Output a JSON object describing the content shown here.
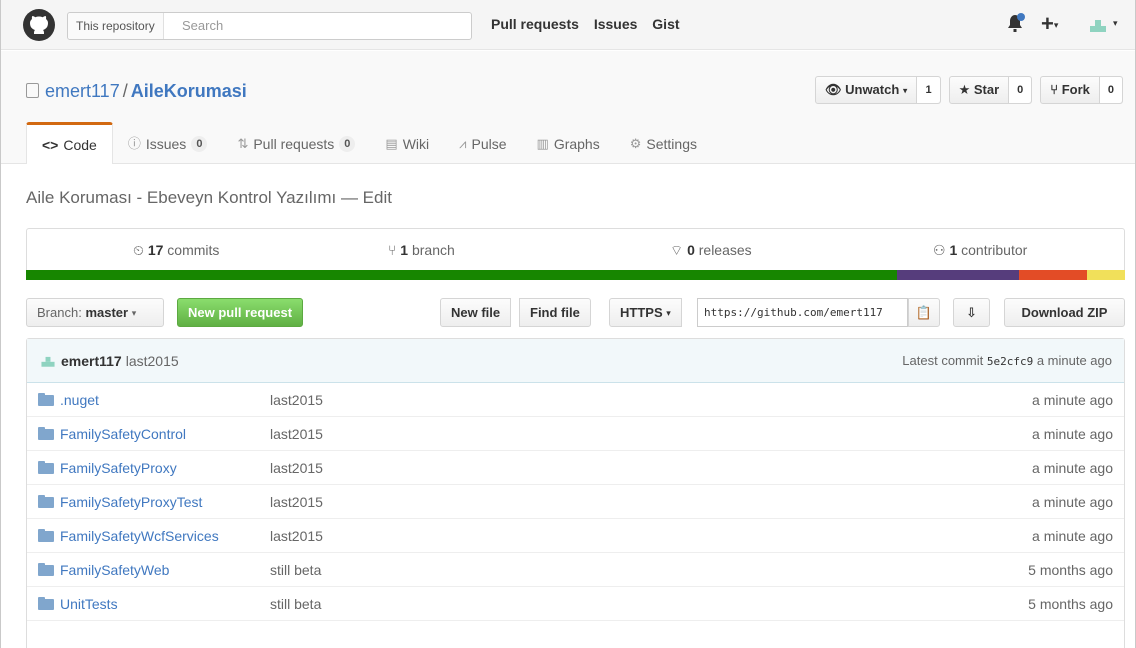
{
  "header": {
    "search_scope": "This repository",
    "search_placeholder": "Search",
    "nav": [
      "Pull requests",
      "Issues",
      "Gist"
    ],
    "plus_label": "+"
  },
  "repo": {
    "owner": "emert117",
    "separator": "/",
    "name": "AileKorumasi",
    "watch_label": "Unwatch",
    "watch_count": "1",
    "star_label": "Star",
    "star_count": "0",
    "fork_label": "Fork",
    "fork_count": "0"
  },
  "tabs": [
    {
      "label": "Code",
      "icon": "code-icon"
    },
    {
      "label": "Issues",
      "count": "0",
      "icon": "issue-icon"
    },
    {
      "label": "Pull requests",
      "count": "0",
      "icon": "pull-request-icon"
    },
    {
      "label": "Wiki",
      "icon": "book-icon"
    },
    {
      "label": "Pulse",
      "icon": "pulse-icon"
    },
    {
      "label": "Graphs",
      "icon": "graph-icon"
    },
    {
      "label": "Settings",
      "icon": "gear-icon"
    }
  ],
  "description": "Aile Koruması - Ebeveyn Kontrol Yazılımı — Edit",
  "summary": {
    "commits_num": "17",
    "commits_label": "commits",
    "branch_num": "1",
    "branch_label": "branch",
    "releases_num": "0",
    "releases_label": "releases",
    "contributor_num": "1",
    "contributor_label": "contributor"
  },
  "language_colors": [
    "#178600",
    "#563d7c",
    "#e34c26",
    "#f1e05a"
  ],
  "filenav": {
    "branch_prefix": "Branch:",
    "branch": "master",
    "new_pr": "New pull request",
    "new_file": "New file",
    "find_file": "Find file",
    "protocol": "HTTPS",
    "clone_url": "https://github.com/emert117",
    "download": "Download ZIP"
  },
  "commit": {
    "author": "emert117",
    "message": "last2015",
    "latest_label": "Latest commit",
    "sha": "5e2cfc9",
    "time": "a minute ago"
  },
  "files": [
    {
      "name": ".nuget",
      "message": "last2015",
      "age": "a minute ago"
    },
    {
      "name": "FamilySafetyControl",
      "message": "last2015",
      "age": "a minute ago"
    },
    {
      "name": "FamilySafetyProxy",
      "message": "last2015",
      "age": "a minute ago"
    },
    {
      "name": "FamilySafetyProxyTest",
      "message": "last2015",
      "age": "a minute ago"
    },
    {
      "name": "FamilySafetyWcfServices",
      "message": "last2015",
      "age": "a minute ago"
    },
    {
      "name": "FamilySafetyWeb",
      "message": "still beta",
      "age": "5 months ago"
    },
    {
      "name": "UnitTests",
      "message": "still beta",
      "age": "5 months ago"
    }
  ]
}
